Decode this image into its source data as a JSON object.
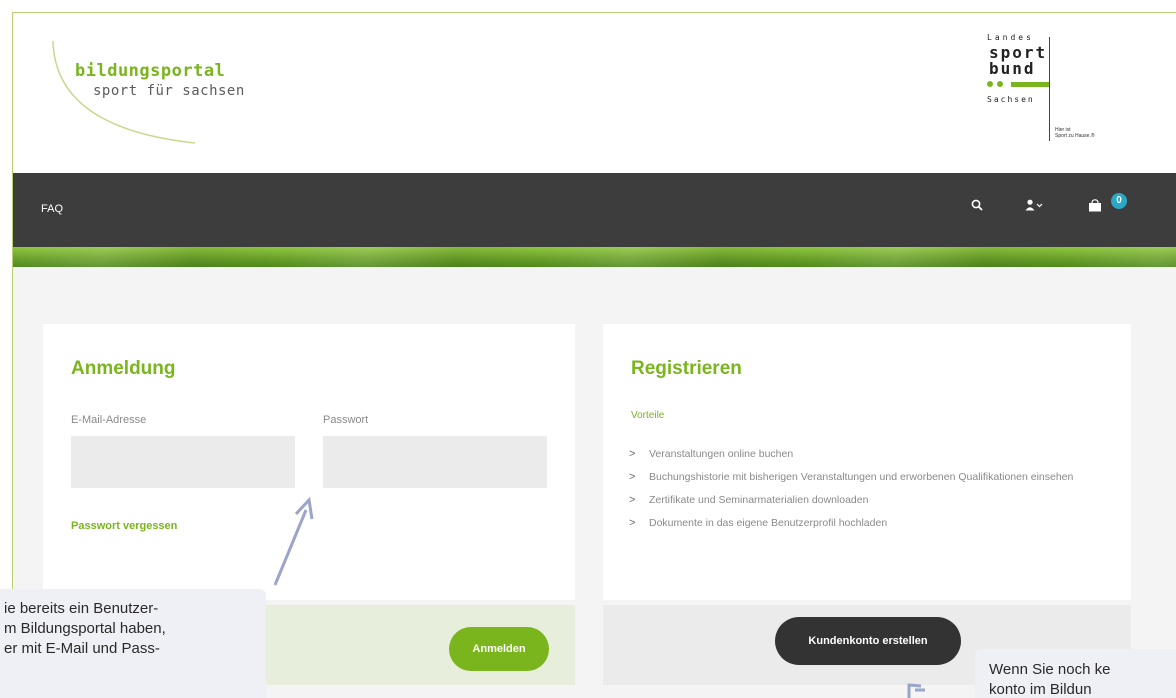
{
  "header": {
    "logo_line1": "bildungsportal",
    "logo_line2": "sport für sachsen",
    "partner_logo": {
      "line1": "Landes",
      "line2": "sport",
      "line3": "bund",
      "line4": "Sachsen",
      "slogan_1": "Hier ist",
      "slogan_2": "Sport zu Hause.®"
    }
  },
  "nav": {
    "faq_label": "FAQ",
    "search_icon": "search-icon",
    "user_icon": "user-icon",
    "cart_icon": "cart-icon",
    "cart_count": "0"
  },
  "login": {
    "title": "Anmeldung",
    "email_label": "E-Mail-Adresse",
    "email_value": "",
    "password_label": "Passwort",
    "password_value": "",
    "forgot_label": "Passwort vergessen",
    "submit_label": "Anmelden"
  },
  "register": {
    "title": "Registrieren",
    "subtitle": "Vorteile",
    "benefits": [
      "Veranstaltungen online buchen",
      "Buchungshistorie mit bisherigen Veranstaltungen und erworbenen Qualifikationen einsehen",
      "Zertifikate und Seminarmaterialien downloaden",
      "Dokumente in das eigene Benutzerprofil hochladen"
    ],
    "create_label": "Kundenkonto erstellen"
  },
  "annotations": {
    "left_lines": [
      "ie bereits ein Benutzer-",
      "m Bildungsportal haben,",
      "er mit E-Mail und Pass-"
    ],
    "right_lines": [
      "Wenn Sie noch ke",
      "konto im Bildun"
    ]
  },
  "colors": {
    "brand_green": "#7ab51d",
    "nav_bg": "#3d3d3d",
    "badge": "#2aa8c7",
    "dark_button": "#333333"
  }
}
